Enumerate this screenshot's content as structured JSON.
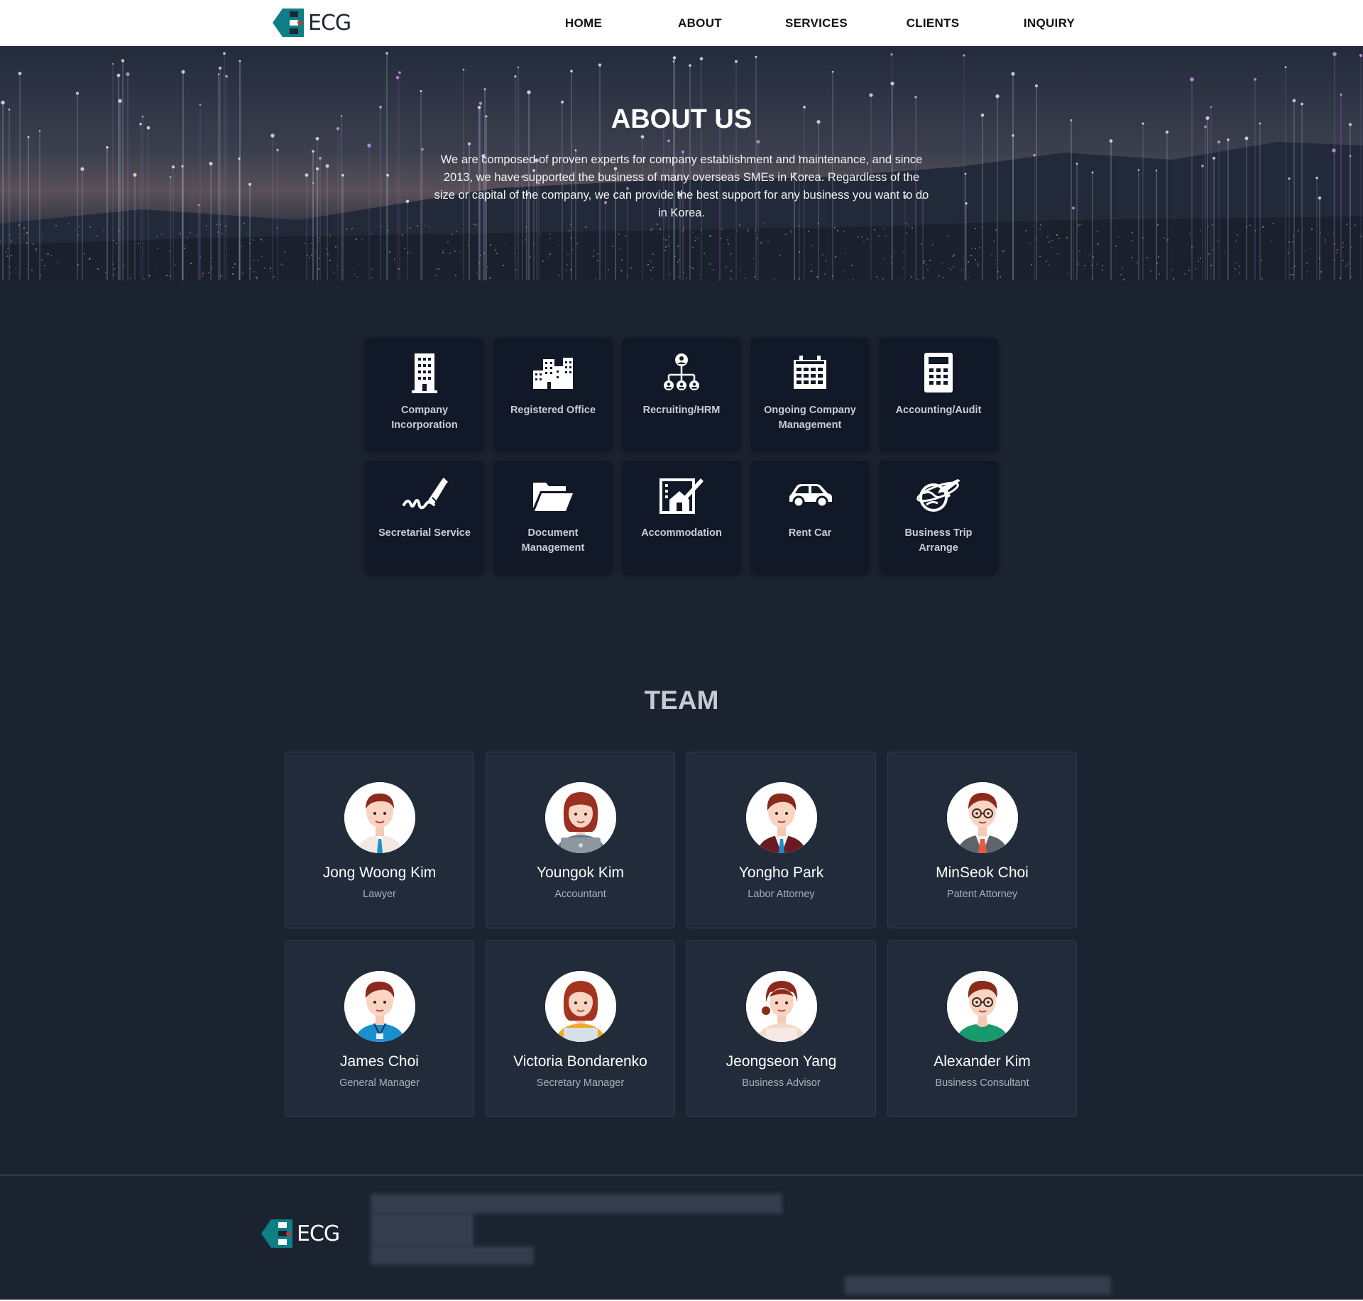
{
  "nav": {
    "logo_text": "ECG",
    "links": [
      "HOME",
      "ABOUT",
      "SERVICES",
      "CLIENTS",
      "INQUIRY"
    ]
  },
  "hero": {
    "title": "ABOUT US",
    "text": "We are composed of proven experts for company establishment and maintenance, and since 2013, we have supported the business of many overseas SMEs in Korea. Regardless of the size or capital of the company, we can provide the best support for any business you want to do in Korea."
  },
  "services": [
    {
      "label": "Company Incorporation",
      "icon": "building-icon"
    },
    {
      "label": "Registered Office",
      "icon": "city-icon"
    },
    {
      "label": "Recruiting/HRM",
      "icon": "org-chart-icon"
    },
    {
      "label": "Ongoing Company Management",
      "icon": "calendar-icon"
    },
    {
      "label": "Accounting/Audit",
      "icon": "calculator-icon"
    },
    {
      "label": "Secretarial Service",
      "icon": "signature-icon"
    },
    {
      "label": "Document Management",
      "icon": "folder-icon"
    },
    {
      "label": "Accommodation",
      "icon": "house-contract-icon"
    },
    {
      "label": "Rent Car",
      "icon": "car-icon"
    },
    {
      "label": "Business Trip Arrange",
      "icon": "globe-plane-icon"
    }
  ],
  "team": {
    "title": "TEAM",
    "members": [
      {
        "name": "Jong Woong Kim",
        "role": "Lawyer"
      },
      {
        "name": "Youngok Kim",
        "role": "Accountant"
      },
      {
        "name": "Yongho Park",
        "role": "Labor Attorney"
      },
      {
        "name": "MinSeok Choi",
        "role": "Patent Attorney"
      },
      {
        "name": "James Choi",
        "role": "General Manager"
      },
      {
        "name": "Victoria Bondarenko",
        "role": "Secretary Manager"
      },
      {
        "name": "Jeongseon Yang",
        "role": "Business Advisor"
      },
      {
        "name": "Alexander Kim",
        "role": "Business Consultant"
      }
    ]
  },
  "footer": {
    "logo_text": "ECG"
  },
  "colors": {
    "logo_teal": "#0e7f84",
    "logo_red": "#e5262d",
    "page_bg": "#1b2330",
    "service_card": "#111827",
    "team_card": "#212b3a"
  }
}
